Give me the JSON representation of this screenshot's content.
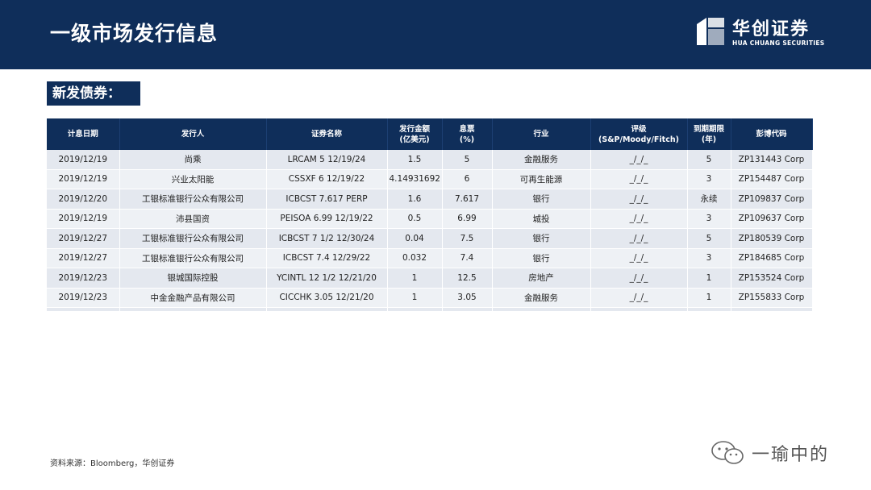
{
  "header": {
    "title": "一级市场发行信息",
    "logo_cn": "华创证券",
    "logo_en": "HUA CHUANG SECURITIES"
  },
  "section_label": "新发债券：",
  "table": {
    "headers": [
      [
        "计息日期"
      ],
      [
        "发行人"
      ],
      [
        "证券名称"
      ],
      [
        "发行金额",
        "(亿美元)"
      ],
      [
        "息票",
        "(%)"
      ],
      [
        "行业"
      ],
      [
        "评级",
        "(S&P/Moody/Fitch)"
      ],
      [
        "到期期限",
        "(年)"
      ],
      [
        "彭博代码"
      ]
    ],
    "rows": [
      [
        "2019/12/19",
        "尚乘",
        "LRCAM 5 12/19/24",
        "1.5",
        "5",
        "金融服务",
        "_/_/_",
        "5",
        "ZP131443 Corp"
      ],
      [
        "2019/12/19",
        "兴业太阳能",
        "CSSXF 6 12/19/22",
        "4.14931692",
        "6",
        "可再生能源",
        "_/_/_",
        "3",
        "ZP154487 Corp"
      ],
      [
        "2019/12/20",
        "工银标准银行公众有限公司",
        "ICBCST 7.617 PERP",
        "1.6",
        "7.617",
        "银行",
        "_/_/_",
        "永续",
        "ZP109837 Corp"
      ],
      [
        "2019/12/19",
        "沛县国资",
        "PEISOA 6.99 12/19/22",
        "0.5",
        "6.99",
        "城投",
        "_/_/_",
        "3",
        "ZP109637 Corp"
      ],
      [
        "2019/12/27",
        "工银标准银行公众有限公司",
        "ICBCST 7 1/2 12/30/24",
        "0.04",
        "7.5",
        "银行",
        "_/_/_",
        "5",
        "ZP180539 Corp"
      ],
      [
        "2019/12/27",
        "工银标准银行公众有限公司",
        "ICBCST 7.4 12/29/22",
        "0.032",
        "7.4",
        "银行",
        "_/_/_",
        "3",
        "ZP184685 Corp"
      ],
      [
        "2019/12/23",
        "银城国际控股",
        "YCINTL 12 1/2 12/21/20",
        "1",
        "12.5",
        "房地产",
        "_/_/_",
        "1",
        "ZP153524 Corp"
      ],
      [
        "2019/12/23",
        "中金金融产品有限公司",
        "CICCHK 3.05 12/21/20",
        "1",
        "3.05",
        "金融服务",
        "_/_/_",
        "1",
        "ZP155833 Corp"
      ]
    ]
  },
  "source": "资料来源：Bloomberg，华创证券",
  "watermark": "一瑜中的",
  "icons": {
    "logo": "hua-chuang-logo-icon",
    "watermark": "wechat-icon"
  },
  "colors": {
    "header_bg": "#0f2e5a",
    "row_bg": "#e4e8ef"
  }
}
